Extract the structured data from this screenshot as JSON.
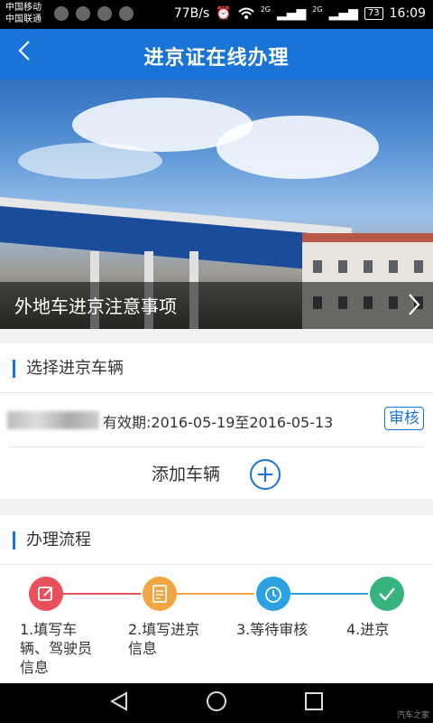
{
  "status_bar": {
    "carrier_1": "中国移动",
    "carrier_2": "中国联通",
    "speed": "77B/s",
    "signal_1": "2G",
    "signal_2": "2G",
    "battery": "73",
    "time": "16:09"
  },
  "header": {
    "back_icon": "chevron-left-icon",
    "title": "进京证在线办理"
  },
  "banner": {
    "caption": "外地车进京注意事项",
    "arrow_icon": "chevron-right-icon"
  },
  "vehicle_section": {
    "title": "选择进京车辆",
    "vehicle": {
      "validity": "有效期:2016-05-19至2016-05-13",
      "audit_label": "审核"
    },
    "add_vehicle_label": "添加车辆",
    "add_icon": "plus-circle-icon"
  },
  "process_section": {
    "title": "办理流程",
    "steps": [
      {
        "icon": "edit-icon",
        "color": "#e8505b",
        "label_1": "1.填写车",
        "label_2": "辆、驾驶员",
        "label_3": "信息"
      },
      {
        "icon": "document-icon",
        "color": "#f2a541",
        "label_1": "2.填写进京",
        "label_2": "信息",
        "label_3": ""
      },
      {
        "icon": "alarm-clock-icon",
        "color": "#2aa1e0",
        "label_1": "3.等待审核",
        "label_2": "",
        "label_3": ""
      },
      {
        "icon": "check-icon",
        "color": "#37b37e",
        "label_1": "4.进京",
        "label_2": "",
        "label_3": ""
      }
    ],
    "connector_colors": [
      "#e8505b",
      "#f2a541",
      "#2aa1e0"
    ]
  },
  "nav_keys": {
    "back_icon": "triangle-back-icon",
    "home_icon": "circle-home-icon",
    "recent_icon": "square-recent-icon"
  },
  "watermark": "汽车之家"
}
